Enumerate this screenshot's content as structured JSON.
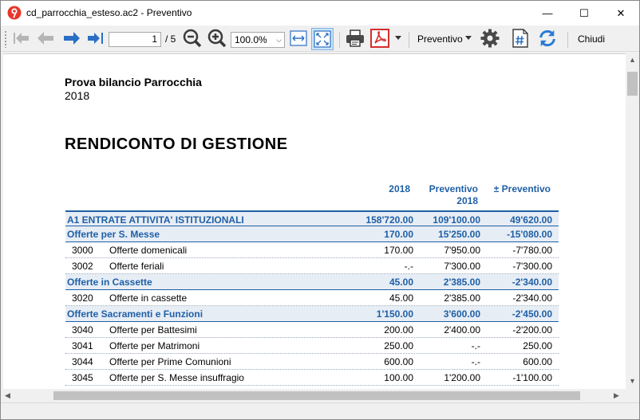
{
  "window": {
    "title": "cd_parrocchia_esteso.ac2 - Preventivo",
    "minimize": "—",
    "maximize": "☐",
    "close": "✕"
  },
  "toolbar": {
    "page_current": "1",
    "page_total": "/ 5",
    "zoom": "100.0%",
    "report_dropdown": "Preventivo",
    "close_label": "Chiudi",
    "colors": {
      "accent": "#1f5fa6",
      "pdf_red": "#d32f2f",
      "refresh_blue": "#2a7bd4"
    }
  },
  "document": {
    "company": "Prova bilancio Parrocchia",
    "year": "2018",
    "heading": "RENDICONTO DI GESTIONE",
    "columns": [
      "2018",
      "Preventivo",
      "2018",
      "± Preventivo"
    ],
    "rows": [
      {
        "kind": "section",
        "title": "A1 ENTRATE ATTIVITA' ISTITUZIONALI",
        "a": "158'720.00",
        "b": "109'100.00",
        "c": "49'620.00"
      },
      {
        "kind": "section",
        "title": "Offerte per S. Messe",
        "a": "170.00",
        "b": "15'250.00",
        "c": "-15'080.00"
      },
      {
        "kind": "item",
        "code": "3000",
        "desc": "Offerte domenicali",
        "a": "170.00",
        "b": "7'950.00",
        "c": "-7'780.00"
      },
      {
        "kind": "item",
        "code": "3002",
        "desc": "Offerte feriali",
        "a": "-.-",
        "b": "7'300.00",
        "c": "-7'300.00"
      },
      {
        "kind": "section",
        "title": "Offerte in Cassette",
        "a": "45.00",
        "b": "2'385.00",
        "c": "-2'340.00"
      },
      {
        "kind": "item",
        "code": "3020",
        "desc": "Offerte in cassette",
        "a": "45.00",
        "b": "2'385.00",
        "c": "-2'340.00"
      },
      {
        "kind": "section",
        "title": "Offerte Sacramenti e Funzioni",
        "a": "1'150.00",
        "b": "3'600.00",
        "c": "-2'450.00"
      },
      {
        "kind": "item",
        "code": "3040",
        "desc": "Offerte per Battesimi",
        "a": "200.00",
        "b": "2'400.00",
        "c": "-2'200.00"
      },
      {
        "kind": "item",
        "code": "3041",
        "desc": "Offerte per Matrimoni",
        "a": "250.00",
        "b": "-.-",
        "c": "250.00"
      },
      {
        "kind": "item",
        "code": "3044",
        "desc": "Offerte per Prime Comunioni",
        "a": "600.00",
        "b": "-.-",
        "c": "600.00"
      },
      {
        "kind": "item",
        "code": "3045",
        "desc": "Offerte per S. Messe insuffragio",
        "a": "100.00",
        "b": "1'200.00",
        "c": "-1'100.00"
      }
    ]
  }
}
